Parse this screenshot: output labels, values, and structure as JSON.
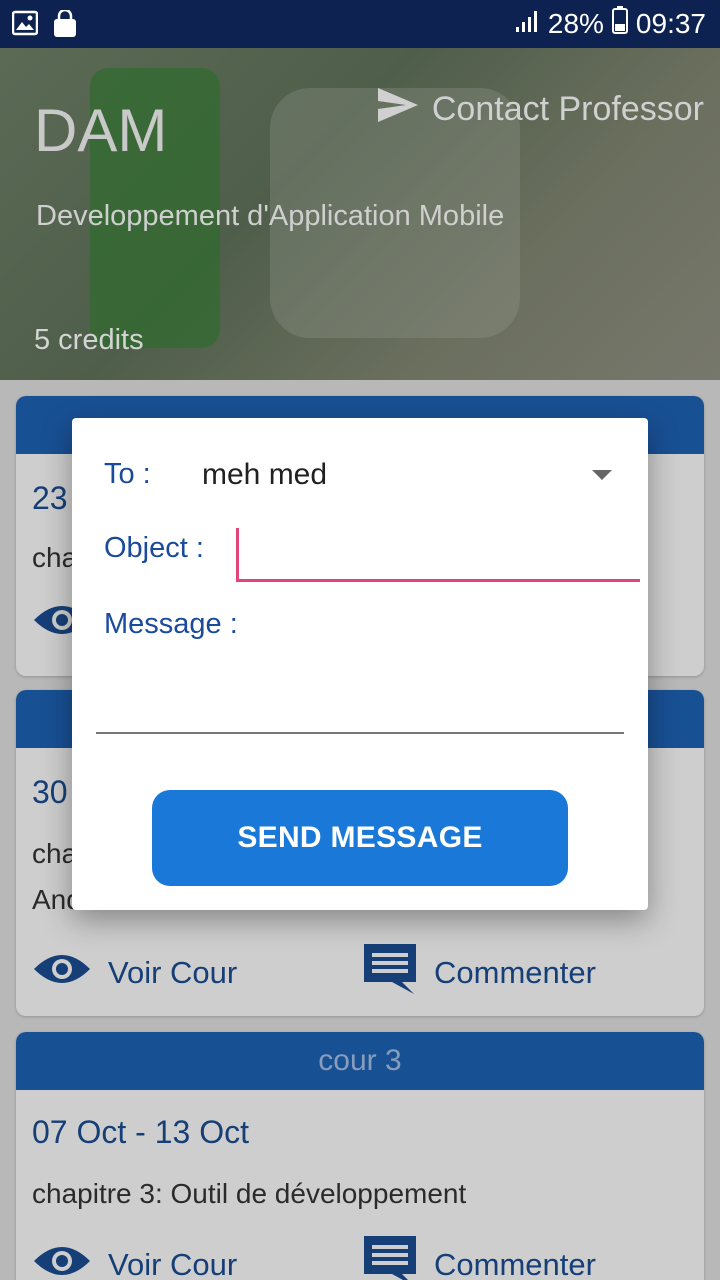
{
  "status_bar": {
    "battery": "28%",
    "time": "09:37"
  },
  "header": {
    "title": "DAM",
    "subtitle": "Developpement d'Application Mobile",
    "credits": "5  credits",
    "contact_label": "Contact Professor"
  },
  "courses": [
    {
      "date": "23",
      "chapter": "cha",
      "view_label": "",
      "comment_label": ""
    },
    {
      "date": "30",
      "chapter": "cha",
      "chapter_line2": "Android",
      "view_label": "Voir Cour",
      "comment_label": "Commenter"
    },
    {
      "title": "cour 3",
      "date": "07 Oct - 13 Oct",
      "chapter": "chapitre 3: Outil de développement",
      "view_label": "Voir Cour",
      "comment_label": "Commenter"
    }
  ],
  "dialog": {
    "to_label": "To :",
    "to_value": "meh med",
    "object_label": "Object :",
    "object_value": "",
    "message_label": "Message :",
    "message_value": "",
    "send_label": "SEND MESSAGE"
  },
  "colors": {
    "primary": "#1d5fae",
    "accent": "#e0457b",
    "button": "#1a78d8"
  }
}
